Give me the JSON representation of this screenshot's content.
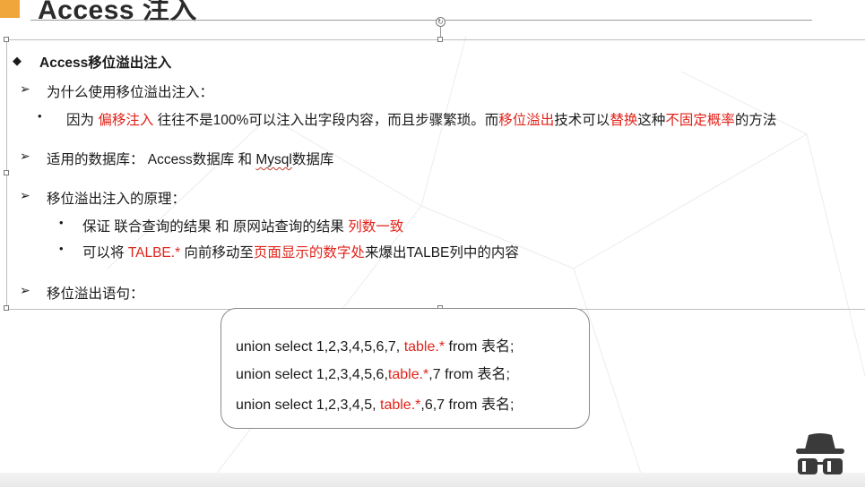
{
  "slide": {
    "title": "Access 注入",
    "heading": "Access移位溢出注入",
    "why_label": "为什么使用移位溢出注入：",
    "reason": {
      "part1": "因为 ",
      "red1": "偏移注入",
      "part2": " 往往不是100%可以注入出字段内容，而且步骤繁琐。而",
      "red2": "移位溢出",
      "part3": "技术可以",
      "red3": "替换",
      "part4": "这种",
      "red4": "不固定概率",
      "part5": "的方法"
    },
    "db_label_prefix": "适用的数据库： Access数据库 和 ",
    "db_mysql": "Mysql",
    "db_suffix": "数据库",
    "principle_label": "移位溢出注入的原理：",
    "principle_1": {
      "text": "保证 联合查询的结果 和 原网站查询的结果 ",
      "red": "列数一致"
    },
    "principle_2": {
      "part1": "可以将 ",
      "red1": "TALBE.*",
      "part2": " 向前移动至",
      "red2": "页面显示的数字处",
      "part3": "来爆出TALBE列中的内容"
    },
    "statement_label": "移位溢出语句："
  },
  "code": [
    {
      "before": "union select 1,2,3,4,5,6,7, ",
      "red": "table.*",
      "after": " from 表名;"
    },
    {
      "before": "union select 1,2,3,4,5,6,",
      "red": "table.*",
      "after": ",7 from 表名;"
    },
    {
      "before": "union select 1,2,3,4,5, ",
      "red": "table.*",
      "after": ",6,7 from 表名;"
    }
  ],
  "colors": {
    "accent": "#f0a63a",
    "highlight": "#e0241b",
    "text": "#1a1a1a"
  },
  "icons": {
    "logo": "spy-hat-glasses-icon",
    "rotate": "rotate-handle-icon"
  }
}
